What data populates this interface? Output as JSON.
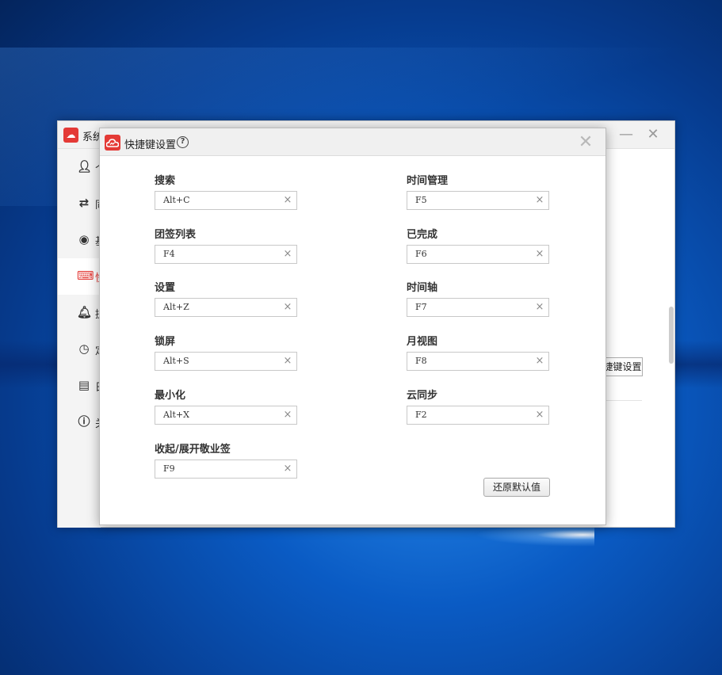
{
  "background_window": {
    "title": "系统",
    "minimize_icon": "minimize-icon",
    "close_icon": "close-icon",
    "sidebar": [
      {
        "icon": "user-icon",
        "letter": "个"
      },
      {
        "icon": "sync-icon",
        "letter": "同"
      },
      {
        "icon": "target-icon",
        "letter": "基"
      },
      {
        "icon": "keyboard-icon",
        "letter": "快",
        "active": true
      },
      {
        "icon": "bell-icon",
        "letter": "提"
      },
      {
        "icon": "clock-icon",
        "letter": "定"
      },
      {
        "icon": "document-icon",
        "letter": "日"
      },
      {
        "icon": "info-icon",
        "letter": "关"
      }
    ],
    "partial_button_label": "捷键设置"
  },
  "dialog": {
    "title": "快捷键设置",
    "help_icon": "help-icon",
    "close_icon": "close-icon",
    "brand_color": "#e43a36",
    "left_column": [
      {
        "label": "搜索",
        "value": "Alt+C"
      },
      {
        "label": "团签列表",
        "value": "F4"
      },
      {
        "label": "设置",
        "value": "Alt+Z"
      },
      {
        "label": "锁屏",
        "value": "Alt+S"
      },
      {
        "label": "最小化",
        "value": "Alt+X"
      },
      {
        "label": "收起/展开敬业签",
        "value": "F9"
      }
    ],
    "right_column": [
      {
        "label": "时间管理",
        "value": "F5"
      },
      {
        "label": "已完成",
        "value": "F6"
      },
      {
        "label": "时间轴",
        "value": "F7"
      },
      {
        "label": "月视图",
        "value": "F8"
      },
      {
        "label": "云同步",
        "value": "F2"
      }
    ],
    "clear_glyph": "×",
    "restore_button_label": "还原默认值"
  }
}
